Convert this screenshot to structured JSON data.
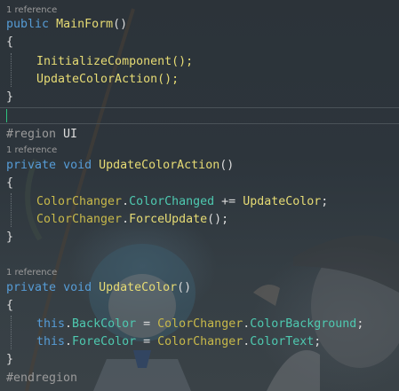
{
  "editor": {
    "codelens": {
      "main_form": "1 reference",
      "update_color_action": "1 reference",
      "update_color": "1 reference"
    },
    "lines": {
      "l1_kw": "public",
      "l1_name": "MainForm",
      "l1_tail": "()",
      "l2": "{",
      "l3": "InitializeComponent();",
      "l4": "UpdateColorAction();",
      "l5": "}",
      "l7_region": "#region",
      "l7_name": " UI",
      "l8_kw1": "private",
      "l8_kw2": "void",
      "l8_name": "UpdateColorAction",
      "l8_tail": "()",
      "l9": "{",
      "l10_cls": "ColorChanger",
      "l10_dot": ".",
      "l10_evt": "ColorChanged",
      "l10_op": " += ",
      "l10_fn": "UpdateColor",
      "l10_end": ";",
      "l11_cls": "ColorChanger",
      "l11_dot": ".",
      "l11_fn": "ForceUpdate",
      "l11_end": "();",
      "l12": "}",
      "l14_kw1": "private",
      "l14_kw2": "void",
      "l14_name": "UpdateColor",
      "l14_tail": "()",
      "l15": "{",
      "l16_this": "this",
      "l16_dot": ".",
      "l16_prop": "BackColor",
      "l16_eq": " = ",
      "l16_cls": "ColorChanger",
      "l16_dot2": ".",
      "l16_prop2": "ColorBackground",
      "l16_end": ";",
      "l17_this": "this",
      "l17_dot": ".",
      "l17_prop": "ForeColor",
      "l17_eq": " = ",
      "l17_cls": "ColorChanger",
      "l17_dot2": ".",
      "l17_prop2": "ColorText",
      "l17_end": ";",
      "l18": "}",
      "l19": "#endregion"
    }
  },
  "colors": {
    "keyword": "#569cd6",
    "method": "#e6db74",
    "class": "#c8b94a",
    "member": "#4ec9b0",
    "preprocessor": "#9b9b9b",
    "plain": "#dcdcdc",
    "codelens": "#9a9a9a"
  }
}
